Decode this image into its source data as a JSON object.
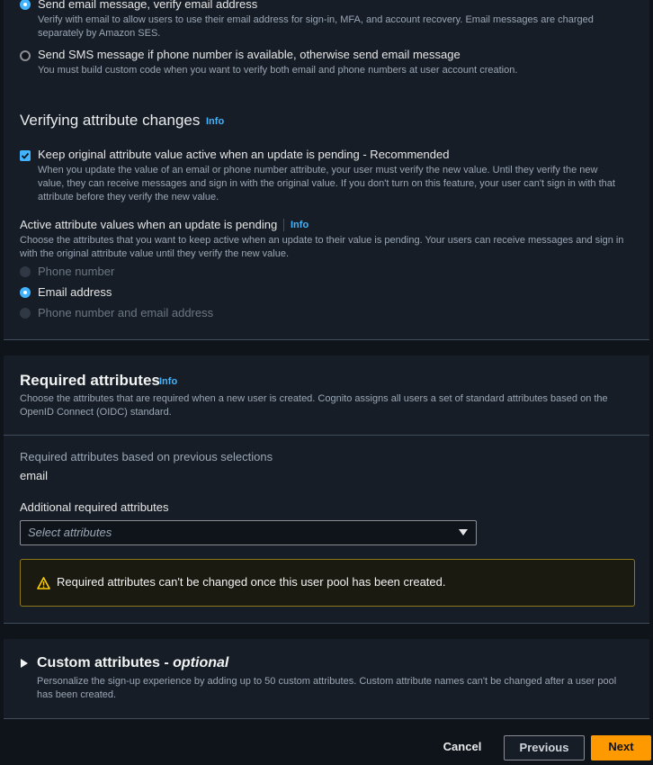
{
  "verification": {
    "option_email": {
      "title": "Send email message, verify email address",
      "desc_line1": "Verify with email to allow users to use their email address for sign-in, MFA, and account recovery. Email messages are charged",
      "desc_line2": "separately by Amazon SES."
    },
    "option_sms": {
      "title": "Send SMS message if phone number is available, otherwise send email message",
      "desc": "You must build custom code when you want to verify both email and phone numbers at user account creation."
    }
  },
  "verifying_changes": {
    "heading": "Verifying attribute changes",
    "info": "Info",
    "keep_original": {
      "label": "Keep original attribute value active when an update is pending - Recommended",
      "desc_line1": "When you update the value of an email or phone number attribute, your user must verify the new value. Until they verify the new",
      "desc_line2": "value, they can receive messages and sign in with the original value. If you don't turn on this feature, your user can't sign in with that",
      "desc_line3": "attribute before they verify the new value."
    },
    "active_values": {
      "label": "Active attribute values when an update is pending",
      "info": "Info",
      "desc_line1": "Choose the attributes that you want to keep active when an update to their value is pending. Your users can receive messages and sign in",
      "desc_line2": "with the original attribute value until they verify the new value.",
      "options": [
        "Phone number",
        "Email address",
        "Phone number and email address"
      ]
    }
  },
  "required": {
    "heading": "Required attributes",
    "info": "Info",
    "desc_line1": "Choose the attributes that are required when a new user is created. Cognito assigns all users a set of standard attributes based on the",
    "desc_line2": "OpenID Connect (OIDC) standard.",
    "based_label": "Required attributes based on previous selections",
    "based_value": "email",
    "additional_label": "Additional required attributes",
    "select_placeholder": "Select attributes",
    "warning": "Required attributes can't be changed once this user pool has been created."
  },
  "custom": {
    "heading": "Custom attributes - ",
    "heading_optional": "optional",
    "desc_line1": "Personalize the sign-up experience by adding up to 50 custom attributes. Custom attribute names can't be changed after a user pool",
    "desc_line2": "has been created."
  },
  "footer": {
    "cancel": "Cancel",
    "previous": "Previous",
    "next": "Next"
  },
  "colors": {
    "accent": "#42b4ff",
    "primary_button": "#ff9900",
    "warning": "#ffd000"
  }
}
